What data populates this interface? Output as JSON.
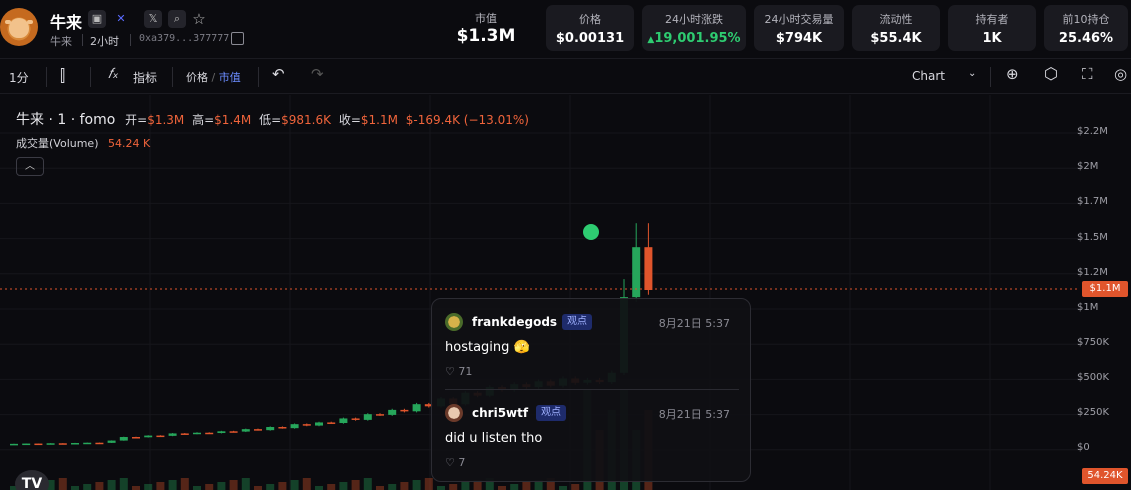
{
  "header": {
    "token_name": "牛来",
    "token_ticker": "牛来",
    "age": "2小时",
    "address": "0xa379...377777",
    "market_cap_label": "市值",
    "market_cap_value": "$1.3M",
    "stats": [
      {
        "label": "价格",
        "value": "$0.00131"
      },
      {
        "label": "24小时涨跌",
        "value": "19,001.95%",
        "direction": "up"
      },
      {
        "label": "24小时交易量",
        "value": "$794K"
      },
      {
        "label": "流动性",
        "value": "$55.4K"
      },
      {
        "label": "持有者",
        "value": "1K"
      },
      {
        "label": "前10持仓",
        "value": "25.46%"
      }
    ]
  },
  "toolbar": {
    "interval": "1分",
    "indicators_label": "指标",
    "price_label": "价格",
    "slash": "/",
    "mcap_label": "市值",
    "chart_label": "Chart"
  },
  "legend": {
    "symbol": "牛来 · 1 · fomo",
    "open_label": "开=",
    "open": "$1.3M",
    "high_label": "高=",
    "high": "$1.4M",
    "low_label": "低=",
    "low": "$981.6K",
    "close_label": "收=",
    "close": "$1.1M",
    "change": "$-169.4K (−13.01%)",
    "volume_label": "成交量(Volume)",
    "volume": "54.24 K"
  },
  "chart_data": {
    "type": "candlestick",
    "y_ticks": [
      "$2.2M",
      "$2M",
      "$1.7M",
      "$1.5M",
      "$1.2M",
      "$1M",
      "$750K",
      "$500K",
      "$250K",
      "$0"
    ],
    "current_price_tag": "$1.1M",
    "volume_tag": "54.24K",
    "up_color": "#26a65b",
    "down_color": "#e0552c",
    "candles": [
      {
        "o": 20,
        "c": 22
      },
      {
        "o": 22,
        "c": 24
      },
      {
        "o": 24,
        "c": 23
      },
      {
        "o": 23,
        "c": 26
      },
      {
        "o": 26,
        "c": 25
      },
      {
        "o": 25,
        "c": 28
      },
      {
        "o": 28,
        "c": 30
      },
      {
        "o": 30,
        "c": 29
      },
      {
        "o": 29,
        "c": 45
      },
      {
        "o": 45,
        "c": 70
      },
      {
        "o": 70,
        "c": 68
      },
      {
        "o": 68,
        "c": 80
      },
      {
        "o": 80,
        "c": 78
      },
      {
        "o": 78,
        "c": 95
      },
      {
        "o": 95,
        "c": 92
      },
      {
        "o": 92,
        "c": 100
      },
      {
        "o": 100,
        "c": 98
      },
      {
        "o": 98,
        "c": 110
      },
      {
        "o": 110,
        "c": 108
      },
      {
        "o": 108,
        "c": 125
      },
      {
        "o": 125,
        "c": 118
      },
      {
        "o": 118,
        "c": 140
      },
      {
        "o": 140,
        "c": 132
      },
      {
        "o": 132,
        "c": 160
      },
      {
        "o": 160,
        "c": 150
      },
      {
        "o": 150,
        "c": 172
      },
      {
        "o": 172,
        "c": 168
      },
      {
        "o": 168,
        "c": 200
      },
      {
        "o": 200,
        "c": 190
      },
      {
        "o": 190,
        "c": 230
      },
      {
        "o": 230,
        "c": 225
      },
      {
        "o": 225,
        "c": 260
      },
      {
        "o": 260,
        "c": 250
      },
      {
        "o": 250,
        "c": 300
      },
      {
        "o": 300,
        "c": 285
      },
      {
        "o": 285,
        "c": 340
      },
      {
        "o": 340,
        "c": 300
      },
      {
        "o": 300,
        "c": 380
      },
      {
        "o": 380,
        "c": 360
      },
      {
        "o": 360,
        "c": 420
      },
      {
        "o": 420,
        "c": 400
      },
      {
        "o": 400,
        "c": 440
      },
      {
        "o": 440,
        "c": 420
      },
      {
        "o": 420,
        "c": 460
      },
      {
        "o": 460,
        "c": 430
      },
      {
        "o": 430,
        "c": 480
      },
      {
        "o": 480,
        "c": 450
      },
      {
        "o": 450,
        "c": 470
      },
      {
        "o": 470,
        "c": 455
      },
      {
        "o": 455,
        "c": 520
      },
      {
        "o": 520,
        "c": 1050
      },
      {
        "o": 1050,
        "c": 1400
      },
      {
        "o": 1400,
        "c": 1100
      }
    ]
  },
  "comments": [
    {
      "user": "frankdegods",
      "badge": "观点",
      "time": "8月21日 5:37",
      "text": "hostaging 🫣",
      "likes": "71"
    },
    {
      "user": "chri5wtf",
      "badge": "观点",
      "time": "8月21日 5:37",
      "text": "did u listen tho",
      "likes": "7"
    }
  ],
  "footer": {
    "tv_logo": "TV"
  }
}
